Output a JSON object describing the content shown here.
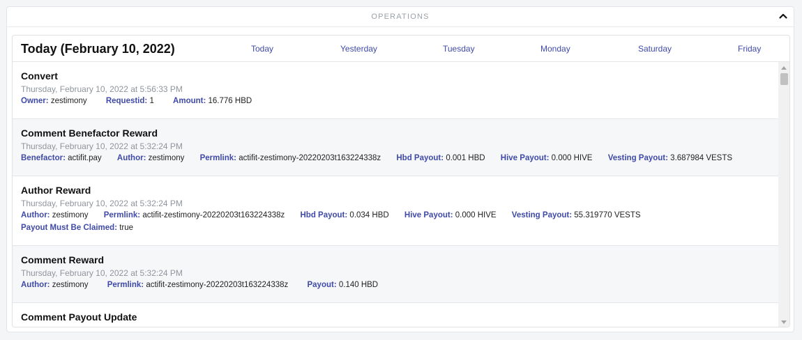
{
  "panel": {
    "title": "OPERATIONS"
  },
  "day": {
    "title": "Today (February 10, 2022)",
    "tabs": [
      "Today",
      "Yesterday",
      "Tuesday",
      "Monday",
      "Saturday",
      "Friday"
    ]
  },
  "operations": [
    {
      "title": "Convert",
      "time": "Thursday, February 10, 2022 at 5:56:33 PM",
      "fields": [
        {
          "key": "Owner:",
          "val": "zestimony"
        },
        {
          "key": "Requestid:",
          "val": "1"
        },
        {
          "key": "Amount:",
          "val": "16.776 HBD"
        }
      ]
    },
    {
      "title": "Comment Benefactor Reward",
      "time": "Thursday, February 10, 2022 at 5:32:24 PM",
      "fields": [
        {
          "key": "Benefactor:",
          "val": "actifit.pay"
        },
        {
          "key": "Author:",
          "val": "zestimony"
        },
        {
          "key": "Permlink:",
          "val": "actifit-zestimony-20220203t163224338z"
        },
        {
          "key": "Hbd Payout:",
          "val": "0.001 HBD"
        },
        {
          "key": "Hive Payout:",
          "val": "0.000 HIVE"
        },
        {
          "key": "Vesting Payout:",
          "val": "3.687984 VESTS"
        }
      ]
    },
    {
      "title": "Author Reward",
      "time": "Thursday, February 10, 2022 at 5:32:24 PM",
      "fields": [
        {
          "key": "Author:",
          "val": "zestimony"
        },
        {
          "key": "Permlink:",
          "val": "actifit-zestimony-20220203t163224338z"
        },
        {
          "key": "Hbd Payout:",
          "val": "0.034 HBD"
        },
        {
          "key": "Hive Payout:",
          "val": "0.000 HIVE"
        },
        {
          "key": "Vesting Payout:",
          "val": "55.319770 VESTS"
        },
        {
          "key": "Payout Must Be Claimed:",
          "val": "true"
        }
      ]
    },
    {
      "title": "Comment Reward",
      "time": "Thursday, February 10, 2022 at 5:32:24 PM",
      "fields": [
        {
          "key": "Author:",
          "val": "zestimony"
        },
        {
          "key": "Permlink:",
          "val": "actifit-zestimony-20220203t163224338z"
        },
        {
          "key": "Payout:",
          "val": "0.140 HBD"
        }
      ]
    },
    {
      "title": "Comment Payout Update",
      "time": "",
      "fields": []
    }
  ]
}
